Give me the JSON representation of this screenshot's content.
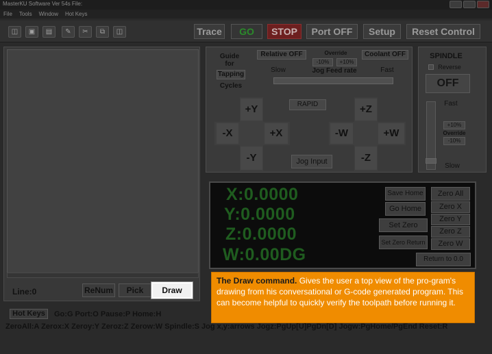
{
  "window": {
    "title": "MasterKU Software Ver 54s File:"
  },
  "menu": [
    "File",
    "Tools",
    "Window",
    "Hot Keys"
  ],
  "toolbar": {
    "icons": [
      "open-icon",
      "save-icon",
      "print-icon",
      "edit-icon",
      "cut-icon",
      "copy-icon",
      "paste-icon"
    ],
    "trace": "Trace",
    "go": "GO",
    "stop": "STOP",
    "port": "Port OFF",
    "setup": "Setup",
    "reset": "Reset Control"
  },
  "left": {
    "line_label": "Line:0",
    "renum": "ReNum",
    "pick": "Pick",
    "draw": "Draw"
  },
  "jog": {
    "guide_label": "Guide for",
    "tapping": "Tapping",
    "cycles": "Cycles",
    "relative": "Relative OFF",
    "override_label": "Override",
    "minus10": "-10%",
    "plus10": "+10%",
    "coolant": "Coolant OFF",
    "slow": "Slow",
    "feed_rate": "Jog Feed rate",
    "fast": "Fast",
    "rapid": "RAPID",
    "plus_y": "+Y",
    "minus_x": "-X",
    "plus_x": "+X",
    "minus_y": "-Y",
    "plus_z": "+Z",
    "minus_w": "-W",
    "plus_w": "+W",
    "minus_z": "-Z",
    "jog_input": "Jog Input"
  },
  "spindle": {
    "title": "SPINDLE",
    "reverse": "Reverse",
    "off": "OFF",
    "fast": "Fast",
    "plus10": "+10%",
    "override": "Override",
    "minus10": "-10%",
    "slow": "Slow"
  },
  "dro": {
    "x": "X:0.0000",
    "y": "Y:0.0000",
    "z": "Z:0.0000",
    "w": "W:0.00DG",
    "save_home": "Save Home",
    "go_home": "Go Home",
    "set_zero": "Set Zero",
    "set_zero_return": "Set Zero Return",
    "zero_all": "Zero All",
    "zero_x": "Zero X",
    "zero_y": "Zero Y",
    "zero_z": "Zero Z",
    "zero_w": "Zero W",
    "return_to_0": "Return to 0.0"
  },
  "callout": {
    "title": "The Draw command.",
    "body": "Gives the user a top view of the pro-gram's drawing from his conversational or G-code generated program. This can become helpful to quickly verify the toolpath before running it."
  },
  "bottom": {
    "hot_keys": "Hot Keys",
    "line1": "Go:G  Port:O  Pause:P  Home:H",
    "line2": "ZeroAll:A  Zerox:X  Zeroy:Y  Zeroz:Z  Zerow:W  Spindle:S  Jog x,y:arrows  Jogz:PgUp[U]PgDn[D]  Jogw:PgHome/PgEnd  Reset:R"
  }
}
